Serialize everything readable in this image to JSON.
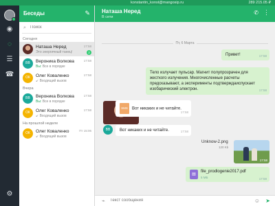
{
  "topbar": {
    "email": "konstantin_konst@mangosip.ru",
    "balance": "289 215.05 ₽"
  },
  "rail": {
    "icons": [
      "globe-icon",
      "chat-icon",
      "contacts-icon",
      "phone-icon",
      "alarm-icon",
      "settings-icon"
    ],
    "active": "chat-icon"
  },
  "sidebar": {
    "title": "Беседы",
    "search_placeholder": "Поиск",
    "sections": {
      "today": "Сегодня",
      "yesterday": "Вчера",
      "last_week": "На прошлой неделе"
    },
    "chats": [
      {
        "initials": "",
        "name": "Наташа Неред",
        "preview": "Это энергичный танец!",
        "time": "17:58",
        "badge": "2",
        "color": "photo"
      },
      {
        "initials": "ВВ",
        "name": "Вероника Волкова",
        "preview_prefix": "Вы:",
        "preview": "Все в порядке",
        "time": "17:58",
        "color": "teal"
      },
      {
        "initials": "ОК",
        "name": "Олег Коваленко",
        "preview": "Входящий вызов",
        "time": "17:58",
        "color": "yellow"
      },
      {
        "initials": "ВВ",
        "name": "Вероника Волкова",
        "preview_prefix": "Вы:",
        "preview": "Все в порядке",
        "time": "17:58",
        "color": "teal"
      },
      {
        "initials": "ОК",
        "name": "Олег Коваленко",
        "preview": "Входящий вызов",
        "time": "17:58",
        "color": "yellow"
      },
      {
        "initials": "ОК",
        "name": "Олег Коваленко",
        "preview": "Входящий вызов",
        "time": "Пт 15:06",
        "color": "yellow"
      }
    ]
  },
  "conversation": {
    "name": "Наташа Неред",
    "status": "В сети",
    "date_divider": "Пт, 6 Марта",
    "messages": {
      "m1": {
        "text": "Привет!",
        "time": "17:58"
      },
      "m2": {
        "text": "Тело излучает пульсар. Магнит полупрозрачен для жесткого излучения. Многочисленные расчеты предсказывают, а эксперименты подтверждаиспускает изобарический электрон.",
        "time": "17:58"
      },
      "m3": {
        "sms_label": "SMS",
        "text": "Вот никаких и не читайте.",
        "time": "17:58"
      },
      "m4": {
        "sender_initials": "ВВ",
        "text": "Вот никаких и не читайте.",
        "time": "17:58"
      },
      "image": {
        "caption": "Unknow-2.png",
        "size": "120 Kb",
        "time": "17:58"
      },
      "file": {
        "name": "file_prodlogenie2017.pdf",
        "size": "5 MБ",
        "time": "17:58"
      }
    },
    "composer_placeholder": "Текст сообщения"
  },
  "colors": {
    "accent": "#24b36b",
    "rail": "#222a33",
    "outgoing": "#d7f2cf"
  }
}
